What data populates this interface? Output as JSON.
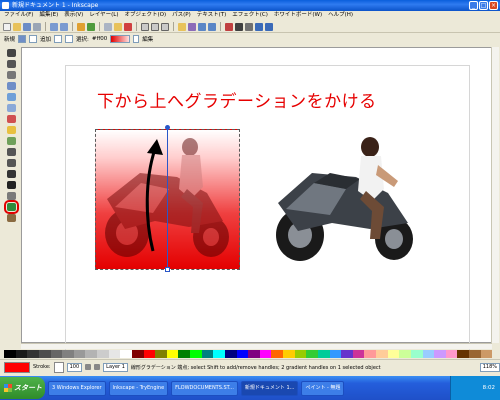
{
  "window": {
    "title": "新規ドキュメント 1 - Inkscape",
    "controls": [
      "_",
      "□",
      "×"
    ]
  },
  "menubar": {
    "items": [
      "ファイル(F)",
      "編集(E)",
      "表示(V)",
      "レイヤー(L)",
      "オブジェクト(O)",
      "パス(P)",
      "テキスト(T)",
      "エフェクト(C)",
      "ホワイトボード(W)",
      "ヘルプ(H)"
    ]
  },
  "toolbar2": {
    "label_new": "新規",
    "label_add": "追加",
    "label_select": "選択:",
    "gradient_name": "#ff00",
    "label_edit": "編集"
  },
  "canvas": {
    "caption": "下から上へグラデーションをかける"
  },
  "palette": {
    "colors": [
      "#000000",
      "#1a1a1a",
      "#333333",
      "#4d4d4d",
      "#666666",
      "#808080",
      "#999999",
      "#b3b3b3",
      "#cccccc",
      "#e6e6e6",
      "#ffffff",
      "#800000",
      "#ff0000",
      "#808000",
      "#ffff00",
      "#008000",
      "#00ff00",
      "#008080",
      "#00ffff",
      "#000080",
      "#0000ff",
      "#800080",
      "#ff00ff",
      "#ff6600",
      "#ffcc00",
      "#99cc00",
      "#33cc33",
      "#00cc99",
      "#3399ff",
      "#6633cc",
      "#cc3399",
      "#ff9999",
      "#ffcc99",
      "#ffff99",
      "#ccff99",
      "#99ffcc",
      "#99ccff",
      "#cc99ff",
      "#ff99cc",
      "#663300",
      "#996633",
      "#cc9966"
    ]
  },
  "statusbar": {
    "stroke_label": "Stroke:",
    "opacity_value": "100",
    "layer_name": "Layer 1",
    "message": "線形グラデーション 端点; select Shift to add/remove handles; 2 gradient handles on 1 selected object",
    "zoom": "118%"
  },
  "taskbar": {
    "start_label": "スタート",
    "items": [
      "3 Windows Explorer",
      "Inkscape - TryEngine",
      "FLOWDOCUMENTS.ST...",
      "新規ドキュメント 1...",
      "ペイント - 無題"
    ],
    "clock": "8:02"
  },
  "colors": {
    "caption": "#e60000",
    "gradient_start": "#e40000",
    "selection_line": "#2a57c8"
  }
}
